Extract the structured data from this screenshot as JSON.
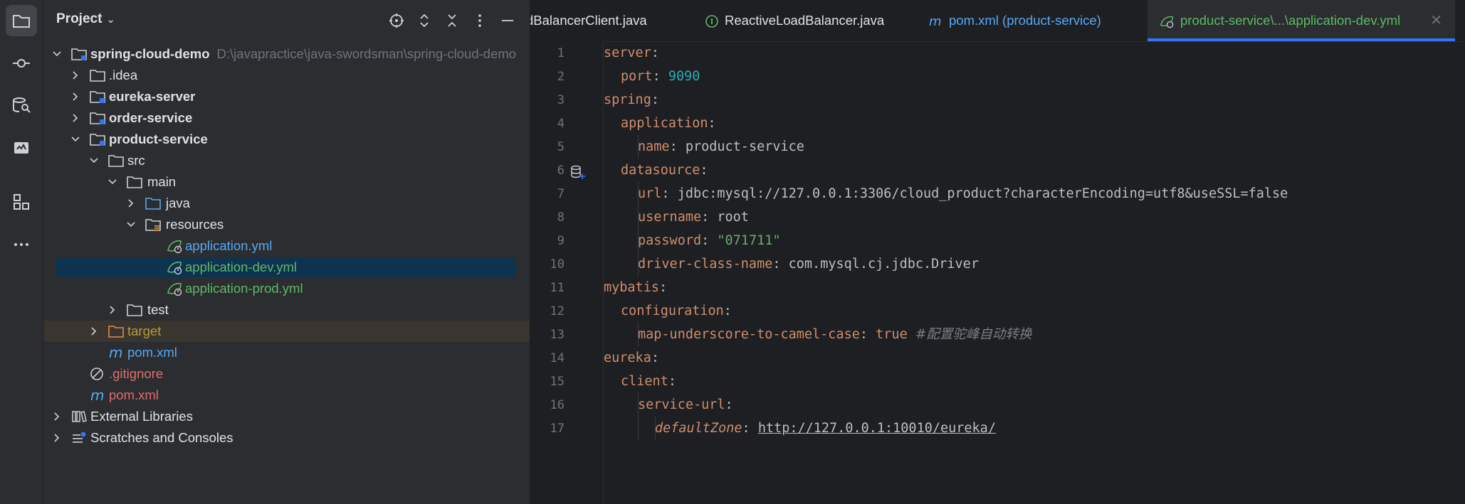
{
  "project_panel": {
    "title": "Project",
    "tree": [
      {
        "label": "spring-cloud-demo",
        "path": "D:\\javapractice\\java-swordsman\\spring-cloud-demo"
      },
      {
        "label": ".idea"
      },
      {
        "label": "eureka-server"
      },
      {
        "label": "order-service"
      },
      {
        "label": "product-service"
      },
      {
        "label": "src"
      },
      {
        "label": "main"
      },
      {
        "label": "java"
      },
      {
        "label": "resources"
      },
      {
        "label": "application.yml"
      },
      {
        "label": "application-dev.yml"
      },
      {
        "label": "application-prod.yml"
      },
      {
        "label": "test"
      },
      {
        "label": "target"
      },
      {
        "label": "pom.xml"
      },
      {
        "label": ".gitignore"
      },
      {
        "label": "pom.xml"
      },
      {
        "label": "External Libraries"
      },
      {
        "label": "Scratches and Consoles"
      }
    ]
  },
  "tabs": [
    {
      "label": "dBalancerClient.java"
    },
    {
      "label": "ReactiveLoadBalancer.java"
    },
    {
      "label": "pom.xml (product-service)"
    },
    {
      "label": "product-service\\...\\application-dev.yml",
      "active": true
    }
  ],
  "editor": {
    "line_numbers": [
      "1",
      "2",
      "3",
      "4",
      "5",
      "6",
      "7",
      "8",
      "9",
      "10",
      "11",
      "12",
      "13",
      "14",
      "15",
      "16",
      "17"
    ],
    "lines": {
      "l1k": "server",
      "l1p": ":",
      "l2k": "port",
      "l2p": ": ",
      "l2v": "9090",
      "l3k": "spring",
      "l3p": ":",
      "l4k": "application",
      "l4p": ":",
      "l5k": "name",
      "l5p": ": ",
      "l5v": "product-service",
      "l6k": "datasource",
      "l6p": ":",
      "l7k": "url",
      "l7p": ": ",
      "l7v": "jdbc:mysql://127.0.0.1:3306/cloud_product?characterEncoding=utf8&useSSL=false",
      "l8k": "username",
      "l8p": ": ",
      "l8v": "root",
      "l9k": "password",
      "l9p": ": ",
      "l9v": "\"071711\"",
      "l10k": "driver-class-name",
      "l10p": ": ",
      "l10v": "com.mysql.cj.jdbc.Driver",
      "l11k": "mybatis",
      "l11p": ":",
      "l12k": "configuration",
      "l12p": ":",
      "l13k": "map-underscore-to-camel-case",
      "l13p": ": ",
      "l13v": "true",
      "l13c": "#配置驼峰自动转换",
      "l14k": "eureka",
      "l14p": ":",
      "l15k": "client",
      "l15p": ":",
      "l16k": "service-url",
      "l16p": ":",
      "l17k": "defaultZone",
      "l17p": ": ",
      "l17v": "http://127.0.0.1:10010/eureka/"
    }
  }
}
